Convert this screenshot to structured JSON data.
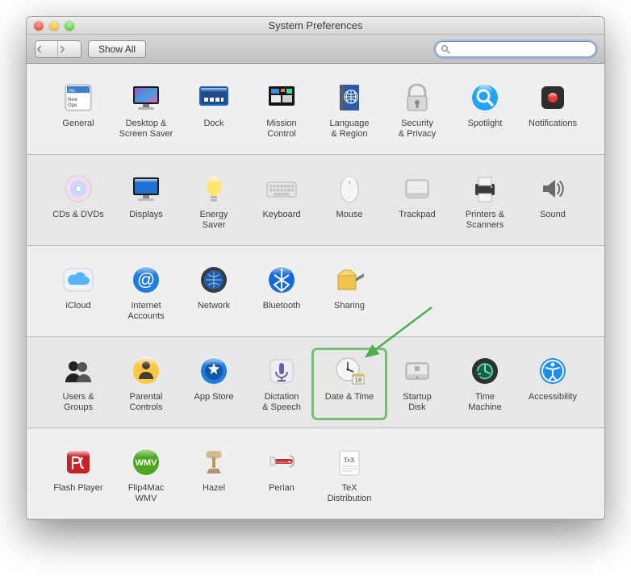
{
  "window": {
    "title": "System Preferences"
  },
  "toolbar": {
    "back_tooltip": "Back",
    "forward_tooltip": "Forward",
    "show_all_label": "Show All",
    "search_placeholder": ""
  },
  "rows": [
    {
      "items": [
        {
          "id": "general",
          "label": "General",
          "icon": "general"
        },
        {
          "id": "desktop",
          "label": "Desktop &\nScreen Saver",
          "icon": "desktop"
        },
        {
          "id": "dock",
          "label": "Dock",
          "icon": "dock"
        },
        {
          "id": "mission-control",
          "label": "Mission\nControl",
          "icon": "mission"
        },
        {
          "id": "language-region",
          "label": "Language\n& Region",
          "icon": "language"
        },
        {
          "id": "security-privacy",
          "label": "Security\n& Privacy",
          "icon": "security"
        },
        {
          "id": "spotlight",
          "label": "Spotlight",
          "icon": "spotlight"
        },
        {
          "id": "notifications",
          "label": "Notifications",
          "icon": "notifications"
        }
      ]
    },
    {
      "items": [
        {
          "id": "cds-dvds",
          "label": "CDs & DVDs",
          "icon": "disc"
        },
        {
          "id": "displays",
          "label": "Displays",
          "icon": "display"
        },
        {
          "id": "energy-saver",
          "label": "Energy\nSaver",
          "icon": "energy"
        },
        {
          "id": "keyboard",
          "label": "Keyboard",
          "icon": "keyboard"
        },
        {
          "id": "mouse",
          "label": "Mouse",
          "icon": "mouse"
        },
        {
          "id": "trackpad",
          "label": "Trackpad",
          "icon": "trackpad"
        },
        {
          "id": "printers",
          "label": "Printers &\nScanners",
          "icon": "printer"
        },
        {
          "id": "sound",
          "label": "Sound",
          "icon": "sound"
        }
      ]
    },
    {
      "items": [
        {
          "id": "icloud",
          "label": "iCloud",
          "icon": "icloud"
        },
        {
          "id": "internet-accounts",
          "label": "Internet\nAccounts",
          "icon": "at"
        },
        {
          "id": "network",
          "label": "Network",
          "icon": "network"
        },
        {
          "id": "bluetooth",
          "label": "Bluetooth",
          "icon": "bluetooth"
        },
        {
          "id": "sharing",
          "label": "Sharing",
          "icon": "sharing"
        }
      ]
    },
    {
      "items": [
        {
          "id": "users-groups",
          "label": "Users &\nGroups",
          "icon": "users"
        },
        {
          "id": "parental-controls",
          "label": "Parental\nControls",
          "icon": "parental"
        },
        {
          "id": "app-store",
          "label": "App Store",
          "icon": "appstore"
        },
        {
          "id": "dictation-speech",
          "label": "Dictation\n& Speech",
          "icon": "dictation"
        },
        {
          "id": "date-time",
          "label": "Date & Time",
          "icon": "datetime",
          "highlight": true
        },
        {
          "id": "startup-disk",
          "label": "Startup\nDisk",
          "icon": "startup"
        },
        {
          "id": "time-machine",
          "label": "Time\nMachine",
          "icon": "timemachine"
        },
        {
          "id": "accessibility",
          "label": "Accessibility",
          "icon": "accessibility"
        }
      ]
    },
    {
      "items": [
        {
          "id": "flash-player",
          "label": "Flash Player",
          "icon": "flash"
        },
        {
          "id": "flip4mac",
          "label": "Flip4Mac\nWMV",
          "icon": "flip4mac"
        },
        {
          "id": "hazel",
          "label": "Hazel",
          "icon": "hazel"
        },
        {
          "id": "perian",
          "label": "Perian",
          "icon": "perian"
        },
        {
          "id": "tex-distribution",
          "label": "TeX\nDistribution",
          "icon": "tex"
        }
      ]
    }
  ],
  "annotation": {
    "arrow_color": "#4bb04b",
    "points_to": "date-time"
  }
}
